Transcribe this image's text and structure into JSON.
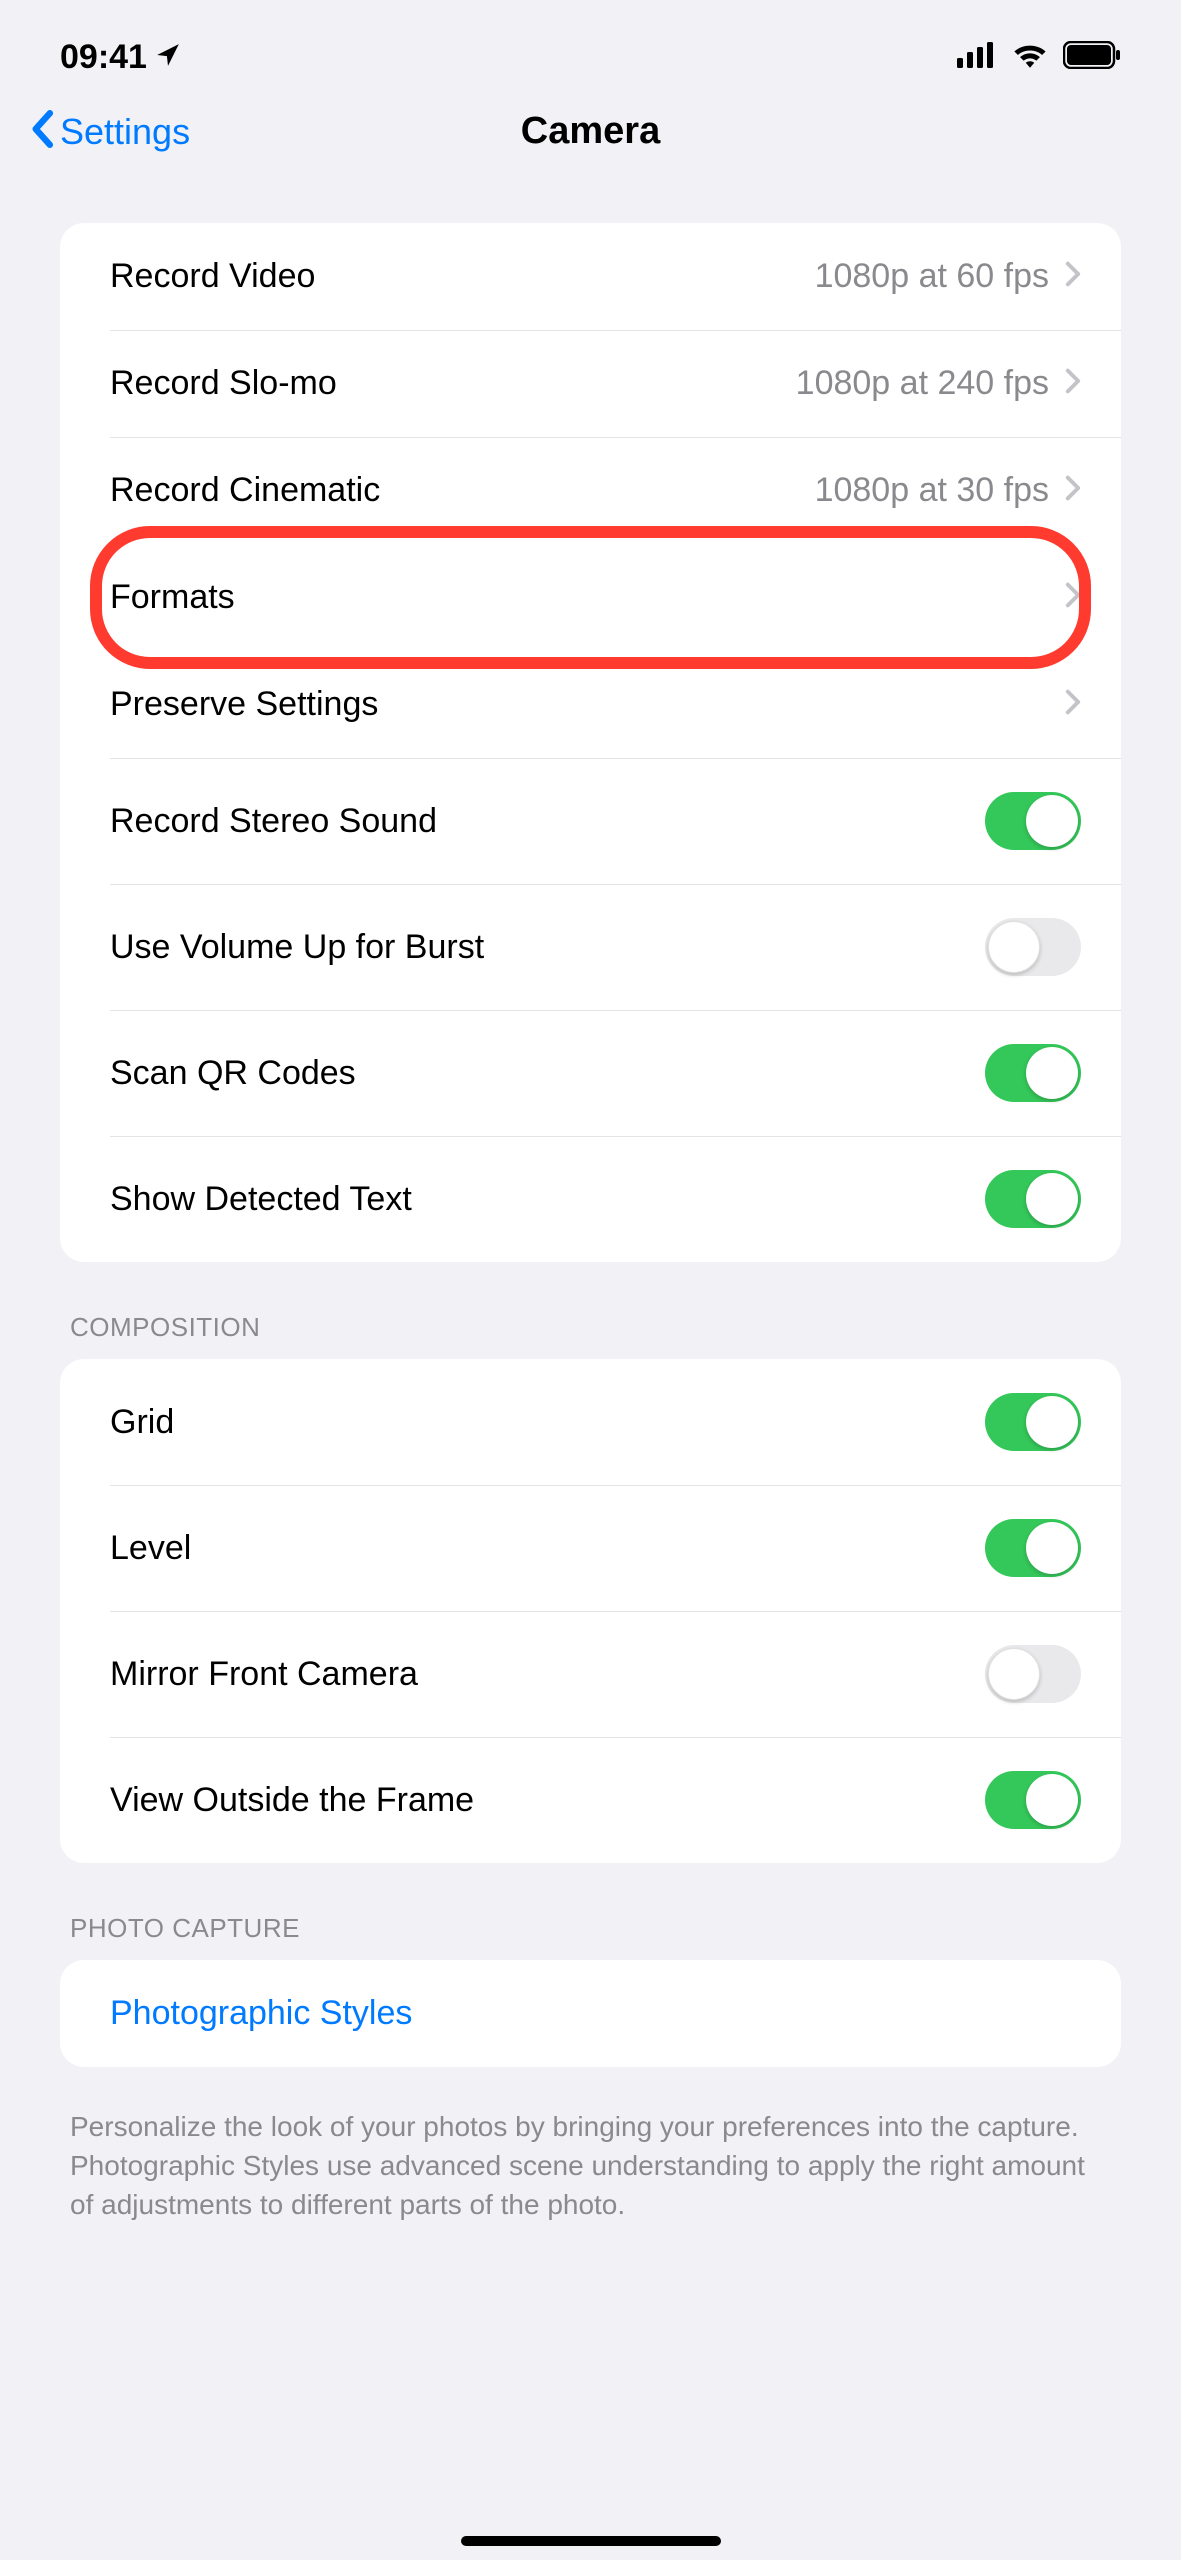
{
  "status": {
    "time": "09:41"
  },
  "nav": {
    "back_label": "Settings",
    "title": "Camera"
  },
  "groups": {
    "main": {
      "record_video": {
        "label": "Record Video",
        "value": "1080p at 60 fps"
      },
      "record_slomo": {
        "label": "Record Slo-mo",
        "value": "1080p at 240 fps"
      },
      "record_cinematic": {
        "label": "Record Cinematic",
        "value": "1080p at 30 fps"
      },
      "formats": {
        "label": "Formats"
      },
      "preserve": {
        "label": "Preserve Settings"
      },
      "stereo": {
        "label": "Record Stereo Sound",
        "on": true
      },
      "volume_burst": {
        "label": "Use Volume Up for Burst",
        "on": false
      },
      "qr": {
        "label": "Scan QR Codes",
        "on": true
      },
      "detected_text": {
        "label": "Show Detected Text",
        "on": true
      }
    },
    "composition": {
      "header": "COMPOSITION",
      "grid": {
        "label": "Grid",
        "on": true
      },
      "level": {
        "label": "Level",
        "on": true
      },
      "mirror": {
        "label": "Mirror Front Camera",
        "on": false
      },
      "outside_frame": {
        "label": "View Outside the Frame",
        "on": true
      }
    },
    "photo_capture": {
      "header": "PHOTO CAPTURE",
      "styles": {
        "label": "Photographic Styles"
      },
      "footer": "Personalize the look of your photos by bringing your preferences into the capture. Photographic Styles use advanced scene understanding to apply the right amount of adjustments to different parts of the photo."
    }
  }
}
